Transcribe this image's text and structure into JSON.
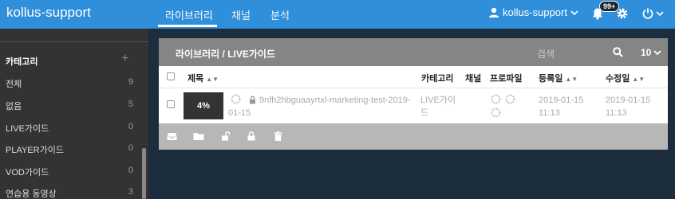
{
  "header": {
    "brand": "kollus-support",
    "tabs": [
      {
        "label": "라이브러리"
      },
      {
        "label": "채널"
      },
      {
        "label": "분석"
      }
    ],
    "user_label": "kollus-support",
    "notification_badge": "99+"
  },
  "sidebar": {
    "category_title": "카테고리",
    "items": [
      {
        "label": "전체",
        "count": "9"
      },
      {
        "label": "없음",
        "count": "5"
      },
      {
        "label": "LIVE가이드",
        "count": "0"
      },
      {
        "label": "PLAYER가이드",
        "count": "0"
      },
      {
        "label": "VOD가이드",
        "count": "0"
      },
      {
        "label": "연습용 동영상",
        "count": "3"
      }
    ]
  },
  "panel": {
    "breadcrumb": "라이브러리 / LIVE가이드",
    "search_placeholder": "검색",
    "page_size": "10",
    "columns": {
      "title": "제목",
      "category": "카테고리",
      "channel": "채널",
      "profile": "프로파일",
      "registered": "등록일",
      "modified": "수정일"
    },
    "rows": [
      {
        "progress": "4%",
        "title": "9nfh2hbguaayrtxl-marketing-test-2019-01-15",
        "category": "LIVE가이드",
        "registered": "2019-01-15 11:13",
        "modified": "2019-01-15 11:13"
      }
    ]
  },
  "colors": {
    "topbar": "#2f8fda",
    "sidebar": "#333333",
    "panel_header": "#858585",
    "panel_footer": "#b7b7b7"
  }
}
